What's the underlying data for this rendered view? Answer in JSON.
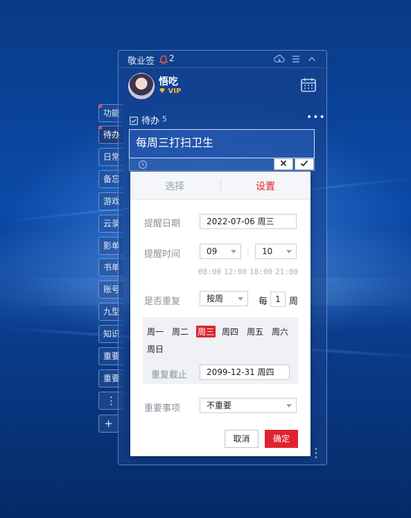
{
  "app": {
    "title": "敬业签",
    "notification_count": "2",
    "icons": [
      "cloud-sync-icon",
      "menu-icon",
      "collapse-icon",
      "bell-icon",
      "calendar-icon"
    ]
  },
  "user": {
    "name": "悟吃",
    "badge": "VIP"
  },
  "side_tabs": [
    {
      "label": "功能",
      "marked": true
    },
    {
      "label": "待办",
      "marked": true,
      "active": true
    },
    {
      "label": "日常"
    },
    {
      "label": "备忘"
    },
    {
      "label": "游戏"
    },
    {
      "label": "云录"
    },
    {
      "label": "影单"
    },
    {
      "label": "书单"
    },
    {
      "label": "账号"
    },
    {
      "label": "九型"
    },
    {
      "label": "知识"
    },
    {
      "label": "重要"
    },
    {
      "label": "重要"
    },
    {
      "label": "⋮"
    },
    {
      "label": "+"
    }
  ],
  "todo": {
    "title": "待办",
    "count": "5",
    "input_value": "每周三打扫卫生"
  },
  "dialog": {
    "tabs": [
      "选择",
      "设置"
    ],
    "active_tab": "设置",
    "remind_date_label": "提醒日期",
    "remind_date_value": "2022-07-06 周三",
    "remind_time_label": "提醒时间",
    "hour": "09",
    "minute": "10",
    "time_separator": ":",
    "quick_times": [
      "08:00",
      "12:00",
      "18:00",
      "21:00"
    ],
    "repeat_label": "是否重复",
    "repeat_mode": "按周",
    "every_label": "每",
    "interval": "1",
    "unit_label": "周",
    "weekdays": [
      "周一",
      "周二",
      "周三",
      "周四",
      "周五",
      "周六",
      "周日"
    ],
    "selected_weekday": "周三",
    "repeat_end_label": "重复截止",
    "repeat_end_value": "2099-12-31 周四",
    "importance_label": "重要事项",
    "importance_value": "不重要",
    "cancel_label": "取消",
    "confirm_label": "确定",
    "accent_color": "#e0242e"
  }
}
